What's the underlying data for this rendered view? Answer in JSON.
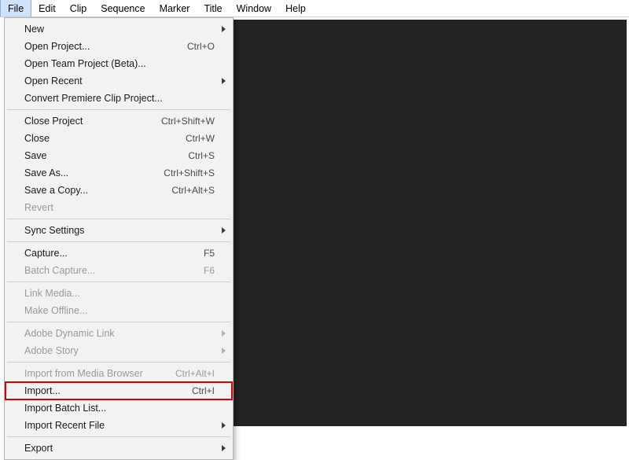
{
  "menubar": [
    "File",
    "Edit",
    "Clip",
    "Sequence",
    "Marker",
    "Title",
    "Window",
    "Help"
  ],
  "file_menu": {
    "groups": [
      [
        {
          "label": "New",
          "submenu": true
        },
        {
          "label": "Open Project...",
          "shortcut": "Ctrl+O"
        },
        {
          "label": "Open Team Project (Beta)..."
        },
        {
          "label": "Open Recent",
          "submenu": true
        },
        {
          "label": "Convert Premiere Clip Project..."
        }
      ],
      [
        {
          "label": "Close Project",
          "shortcut": "Ctrl+Shift+W"
        },
        {
          "label": "Close",
          "shortcut": "Ctrl+W"
        },
        {
          "label": "Save",
          "shortcut": "Ctrl+S"
        },
        {
          "label": "Save As...",
          "shortcut": "Ctrl+Shift+S"
        },
        {
          "label": "Save a Copy...",
          "shortcut": "Ctrl+Alt+S"
        },
        {
          "label": "Revert",
          "disabled": true
        }
      ],
      [
        {
          "label": "Sync Settings",
          "submenu": true
        }
      ],
      [
        {
          "label": "Capture...",
          "shortcut": "F5"
        },
        {
          "label": "Batch Capture...",
          "shortcut": "F6",
          "disabled": true
        }
      ],
      [
        {
          "label": "Link Media...",
          "disabled": true
        },
        {
          "label": "Make Offline...",
          "disabled": true
        }
      ],
      [
        {
          "label": "Adobe Dynamic Link",
          "submenu": true,
          "disabled": true
        },
        {
          "label": "Adobe Story",
          "submenu": true,
          "disabled": true
        }
      ],
      [
        {
          "label": "Import from Media Browser",
          "shortcut": "Ctrl+Alt+I",
          "disabled": true
        },
        {
          "label": "Import...",
          "shortcut": "Ctrl+I",
          "highlighted": true
        },
        {
          "label": "Import Batch List..."
        },
        {
          "label": "Import Recent File",
          "submenu": true
        }
      ],
      [
        {
          "label": "Export",
          "submenu": true
        }
      ]
    ]
  }
}
